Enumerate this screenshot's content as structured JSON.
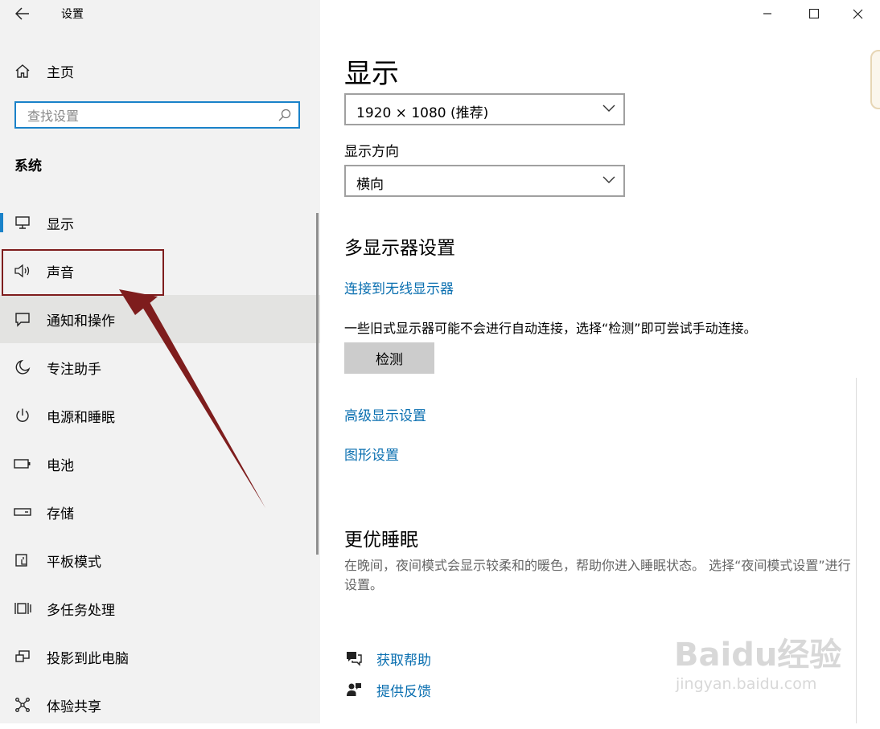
{
  "window": {
    "title": "设置"
  },
  "sidebar": {
    "home_label": "主页",
    "search_placeholder": "查找设置",
    "section_title": "系统",
    "items": [
      {
        "label": "显示",
        "icon": "monitor-icon"
      },
      {
        "label": "声音",
        "icon": "speaker-icon"
      },
      {
        "label": "通知和操作",
        "icon": "notification-icon"
      },
      {
        "label": "专注助手",
        "icon": "moon-icon"
      },
      {
        "label": "电源和睡眠",
        "icon": "power-icon"
      },
      {
        "label": "电池",
        "icon": "battery-icon"
      },
      {
        "label": "存储",
        "icon": "storage-icon"
      },
      {
        "label": "平板模式",
        "icon": "tablet-icon"
      },
      {
        "label": "多任务处理",
        "icon": "multitask-icon"
      },
      {
        "label": "投影到此电脑",
        "icon": "project-icon"
      },
      {
        "label": "体验共享",
        "icon": "share-icon"
      }
    ]
  },
  "main": {
    "title": "显示",
    "resolution_value": "1920 × 1080 (推荐)",
    "orientation_label": "显示方向",
    "orientation_value": "横向",
    "multi_display_title": "多显示器设置",
    "wireless_link": "连接到无线显示器",
    "legacy_note": "一些旧式显示器可能不会进行自动连接，选择“检测”即可尝试手动连接。",
    "detect_button": "检测",
    "advanced_link": "高级显示设置",
    "graphics_link": "图形设置",
    "sleep_title": "更优睡眠",
    "sleep_note": "在晚间，夜间模式会显示较柔和的暖色，帮助你进入睡眠状态。 选择“夜间模式设置”进行设置。",
    "help_link": "获取帮助",
    "feedback_link": "提供反馈"
  },
  "watermark": {
    "line1": "Baidu经验",
    "line2": "jingyan.baidu.com"
  },
  "colors": {
    "accent": "#1a82c9",
    "link": "#0a6fb0",
    "annotation": "#7e1d1d"
  }
}
